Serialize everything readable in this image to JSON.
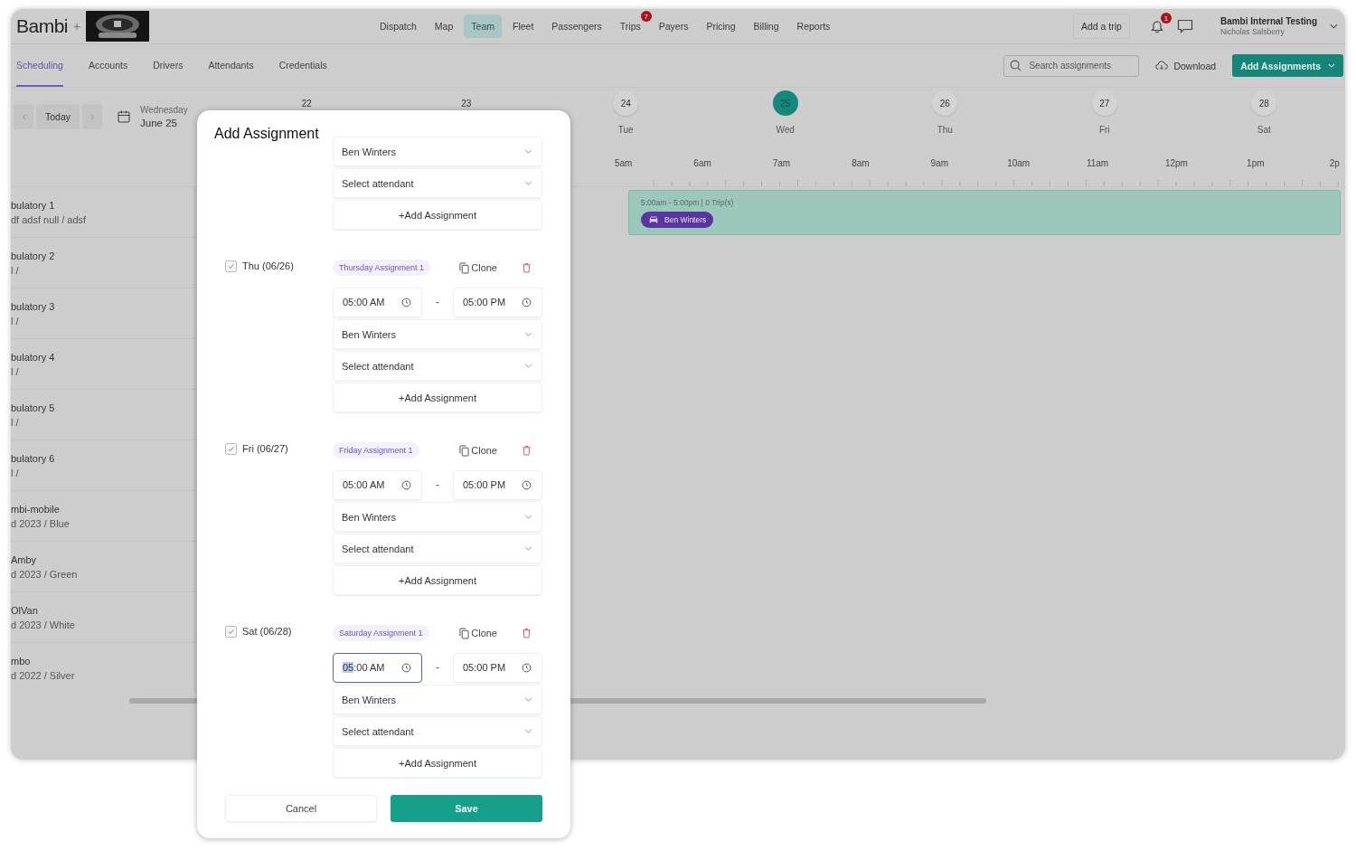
{
  "header": {
    "logo_text": "Bambi",
    "separator": "+",
    "nav": [
      {
        "label": "Dispatch",
        "selected": false
      },
      {
        "label": "Map",
        "selected": false
      },
      {
        "label": "Team",
        "selected": true
      },
      {
        "label": "Fleet",
        "selected": false
      },
      {
        "label": "Passengers",
        "selected": false
      },
      {
        "label": "Trips",
        "selected": false,
        "badge": "7"
      },
      {
        "label": "Payers",
        "selected": false
      },
      {
        "label": "Pricing",
        "selected": false
      },
      {
        "label": "Billing",
        "selected": false
      },
      {
        "label": "Reports",
        "selected": false
      }
    ],
    "add_trip_button": "Add a trip",
    "notifications_badge": "1",
    "account": {
      "org": "Bambi Internal Testing",
      "user": "Nicholas Salsberry"
    }
  },
  "subnav": {
    "tabs": [
      {
        "label": "Scheduling",
        "selected": true
      },
      {
        "label": "Accounts",
        "selected": false
      },
      {
        "label": "Drivers",
        "selected": false
      },
      {
        "label": "Attendants",
        "selected": false
      },
      {
        "label": "Credentials",
        "selected": false
      }
    ],
    "search": {
      "placeholder": "Search assignments"
    },
    "download_button": "Download",
    "add_assignments_button": "Add Assignments"
  },
  "calendar": {
    "today_button": "Today",
    "weekday": "Wednesday",
    "date": "June 25",
    "days": [
      {
        "number": "22",
        "selected": false
      },
      {
        "number": "23",
        "selected": false
      },
      {
        "number": "24",
        "weekday": "Tue",
        "selected": false
      },
      {
        "number": "25",
        "weekday": "Wed",
        "selected": true
      },
      {
        "number": "26",
        "weekday": "Thu",
        "selected": false
      },
      {
        "number": "27",
        "weekday": "Fri",
        "selected": false
      },
      {
        "number": "28",
        "weekday": "Sat",
        "selected": false
      }
    ],
    "hours": [
      "5am",
      "6am",
      "7am",
      "8am",
      "9am",
      "10am",
      "11am",
      "12pm",
      "1pm",
      "2p"
    ],
    "vehicles": [
      {
        "name": "bulatory 1",
        "detail": "df adsf null / adsf"
      },
      {
        "name": "bulatory 2",
        "detail": "l /"
      },
      {
        "name": "bulatory 3",
        "detail": "l /"
      },
      {
        "name": "bulatory 4",
        "detail": "l /"
      },
      {
        "name": "bulatory 5",
        "detail": "l /"
      },
      {
        "name": "bulatory 6",
        "detail": "l /"
      },
      {
        "name": "mbi-mobile",
        "detail": "d 2023 / Blue"
      },
      {
        "name": "Amby",
        "detail": "d 2023 / Green"
      },
      {
        "name": "OlVan",
        "detail": "d 2023 / White"
      },
      {
        "name": "mbo",
        "detail": "d 2022 / Silver"
      }
    ],
    "event": {
      "summary": "5:00am - 5:00pm | 0 Trip(s)",
      "driver": "Ben Winters"
    }
  },
  "modal": {
    "title": "Add Assignment",
    "sections": [
      {
        "kind": "partial",
        "driver": "Ben Winters",
        "attendant_placeholder": "Select attendant",
        "add_button": "+Add Assignment"
      },
      {
        "kind": "day",
        "day_label": "Thu (06/26)",
        "checked": true,
        "tag": "Thursday Assignment 1",
        "clone_button": "Clone",
        "start": {
          "value": "05:00 AM",
          "focused": false
        },
        "time_separator": "-",
        "end": "05:00 PM",
        "driver": "Ben Winters",
        "attendant_placeholder": "Select attendant",
        "add_button": "+Add Assignment"
      },
      {
        "kind": "day",
        "day_label": "Fri (06/27)",
        "checked": true,
        "tag": "Friday Assignment 1",
        "clone_button": "Clone",
        "start": {
          "value": "05:00 AM",
          "focused": false
        },
        "time_separator": "-",
        "end": "05:00 PM",
        "driver": "Ben Winters",
        "attendant_placeholder": "Select attendant",
        "add_button": "+Add Assignment"
      },
      {
        "kind": "day",
        "day_label": "Sat (06/28)",
        "checked": true,
        "tag": "Saturday Assignment 1",
        "clone_button": "Clone",
        "start": {
          "value": "05:00 AM",
          "focused": true
        },
        "time_separator": "-",
        "end": "05:00 PM",
        "driver": "Ben Winters",
        "attendant_placeholder": "Select attendant",
        "add_button": "+Add Assignment"
      }
    ],
    "cancel_button": "Cancel",
    "save_button": "Save"
  }
}
